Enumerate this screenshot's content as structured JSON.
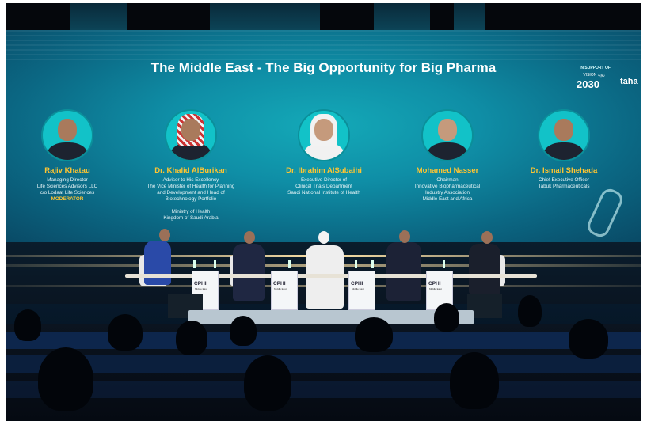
{
  "screen": {
    "title": "The Middle East - The Big Opportunity for Big Pharma",
    "support_label": "IN SUPPORT OF",
    "vision_label": "VISION رؤية",
    "vision_year": "2030",
    "partner_logo": "taha"
  },
  "panelists": [
    {
      "name": "Rajiv Khatau",
      "role": "Managing Director\nLife Sciences Advisors LLC\nc/o Lodaat Life Sciences",
      "tag": "MODERATOR"
    },
    {
      "name": "Dr. Khalid AlBurikan",
      "role": "Advisor to His Excellency\nThe Vice Minister of Health for Planning\nand Development and Head of\nBiotechnology Portfolio\n\nMinistry of Health\nKingdom of Saudi Arabia",
      "tag": ""
    },
    {
      "name": "Dr. Ibrahim AlSubaihi",
      "role": "Executive Director of\nClinical Trials Department\nSaudi National Institute of Health",
      "tag": ""
    },
    {
      "name": "Mohamed Nasser",
      "role": "Chairman\nInnovative Biopharmaceutical\nIndustry Association\nMiddle East and Africa",
      "tag": ""
    },
    {
      "name": "Dr. Ismail Shehada",
      "role": "Chief Executive Officer\nTabuk Pharmaceuticals",
      "tag": ""
    }
  ],
  "podium_logo": "CPHI",
  "podium_sub": "Middle East"
}
